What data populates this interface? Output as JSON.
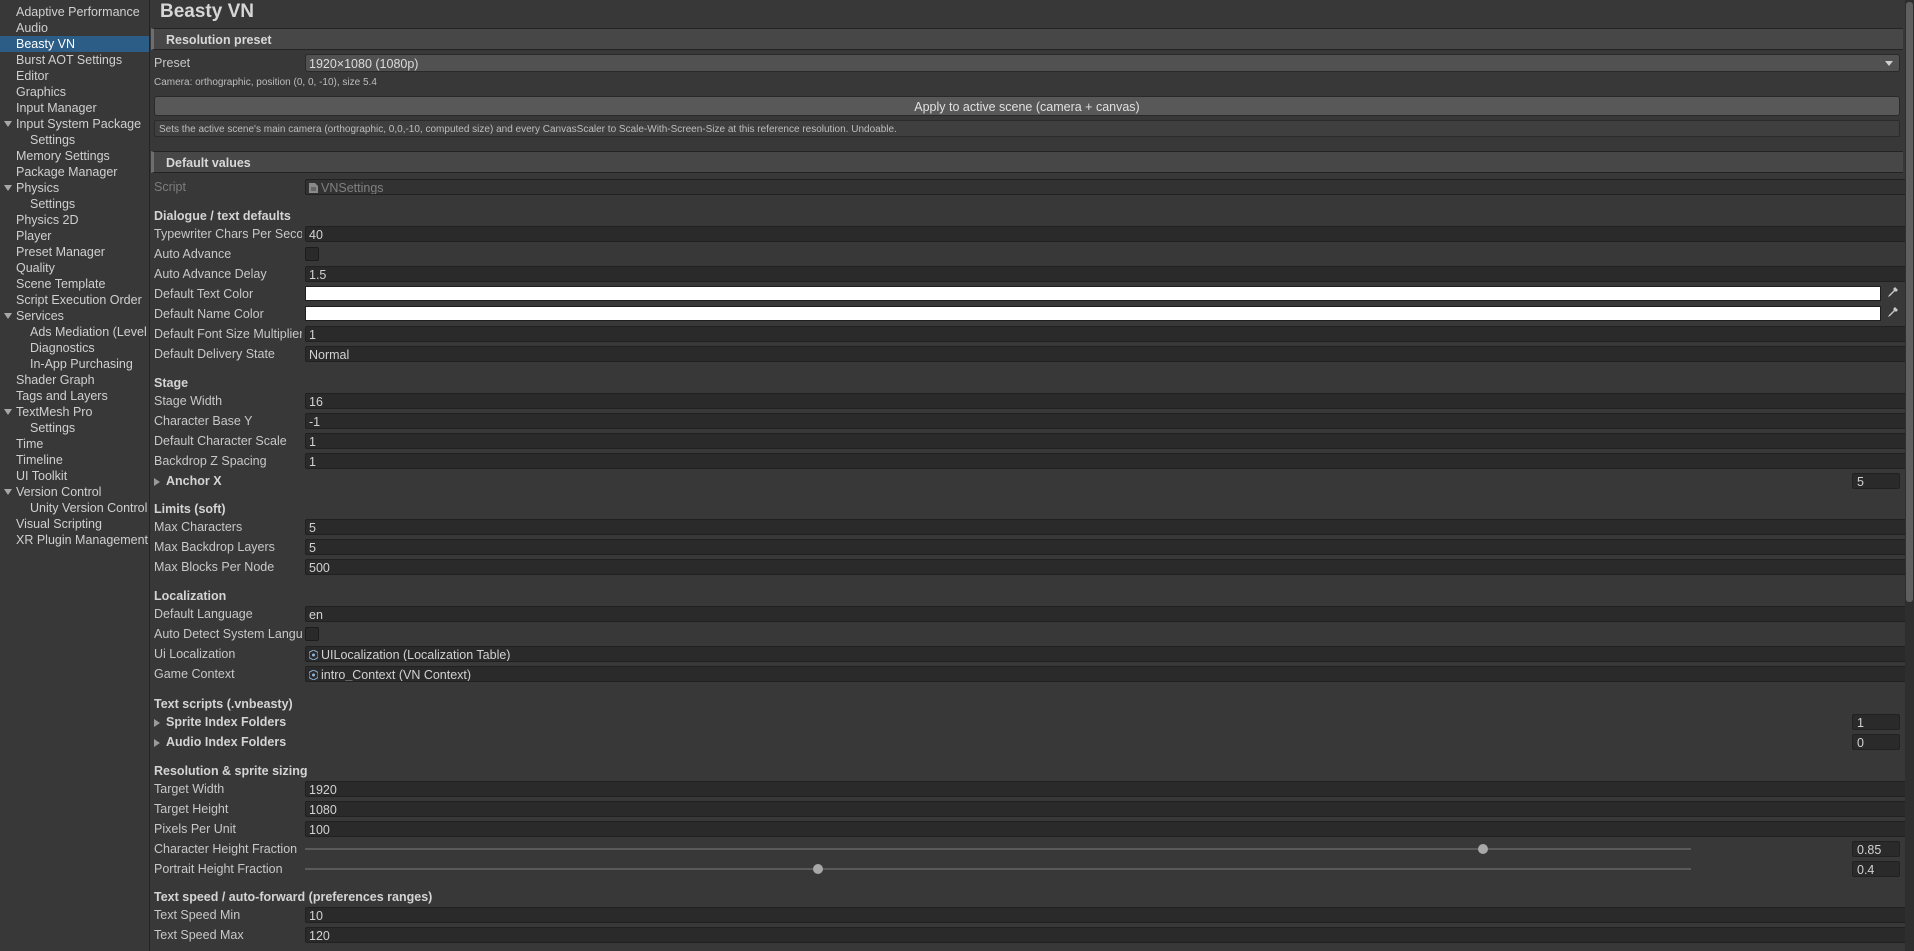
{
  "sidebar": {
    "selected": "Beasty VN",
    "items": [
      {
        "label": "Adaptive Performance",
        "indent": 0,
        "foldout": false
      },
      {
        "label": "Audio",
        "indent": 0,
        "foldout": false
      },
      {
        "label": "Beasty VN",
        "indent": 0,
        "foldout": false
      },
      {
        "label": "Burst AOT Settings",
        "indent": 0,
        "foldout": false
      },
      {
        "label": "Editor",
        "indent": 0,
        "foldout": false
      },
      {
        "label": "Graphics",
        "indent": 0,
        "foldout": false
      },
      {
        "label": "Input Manager",
        "indent": 0,
        "foldout": false
      },
      {
        "label": "Input System Package",
        "indent": 0,
        "foldout": true
      },
      {
        "label": "Settings",
        "indent": 1,
        "foldout": false
      },
      {
        "label": "Memory Settings",
        "indent": 0,
        "foldout": false
      },
      {
        "label": "Package Manager",
        "indent": 0,
        "foldout": false
      },
      {
        "label": "Physics",
        "indent": 0,
        "foldout": true
      },
      {
        "label": "Settings",
        "indent": 1,
        "foldout": false
      },
      {
        "label": "Physics 2D",
        "indent": 0,
        "foldout": false
      },
      {
        "label": "Player",
        "indent": 0,
        "foldout": false
      },
      {
        "label": "Preset Manager",
        "indent": 0,
        "foldout": false
      },
      {
        "label": "Quality",
        "indent": 0,
        "foldout": false
      },
      {
        "label": "Scene Template",
        "indent": 0,
        "foldout": false
      },
      {
        "label": "Script Execution Order",
        "indent": 0,
        "foldout": false
      },
      {
        "label": "Services",
        "indent": 0,
        "foldout": true
      },
      {
        "label": "Ads Mediation (Level",
        "indent": 1,
        "foldout": false
      },
      {
        "label": "Diagnostics",
        "indent": 1,
        "foldout": false
      },
      {
        "label": "In-App Purchasing",
        "indent": 1,
        "foldout": false
      },
      {
        "label": "Shader Graph",
        "indent": 0,
        "foldout": false
      },
      {
        "label": "Tags and Layers",
        "indent": 0,
        "foldout": false
      },
      {
        "label": "TextMesh Pro",
        "indent": 0,
        "foldout": true
      },
      {
        "label": "Settings",
        "indent": 1,
        "foldout": false
      },
      {
        "label": "Time",
        "indent": 0,
        "foldout": false
      },
      {
        "label": "Timeline",
        "indent": 0,
        "foldout": false
      },
      {
        "label": "UI Toolkit",
        "indent": 0,
        "foldout": false
      },
      {
        "label": "Version Control",
        "indent": 0,
        "foldout": true
      },
      {
        "label": "Unity Version Control",
        "indent": 1,
        "foldout": false
      },
      {
        "label": "Visual Scripting",
        "indent": 0,
        "foldout": false
      },
      {
        "label": "XR Plugin Management",
        "indent": 0,
        "foldout": false
      }
    ]
  },
  "page": {
    "title": "Beasty VN"
  },
  "resolution": {
    "header": "Resolution preset",
    "preset_label": "Preset",
    "preset_value": "1920×1080 (1080p)",
    "camera_note": "Camera: orthographic, position (0, 0, -10), size 5.4",
    "apply_button": "Apply to active scene (camera + canvas)",
    "help_text": "Sets the active scene's main camera (orthographic, 0,0,-10, computed size) and every CanvasScaler to Scale-With-Screen-Size at this reference resolution. Undoable."
  },
  "defaults": {
    "header": "Default values",
    "script_label": "Script",
    "script_value": "VNSettings"
  },
  "dialogue": {
    "title": "Dialogue / text defaults",
    "typewriter_label": "Typewriter Chars Per Seco",
    "typewriter_value": "40",
    "auto_advance_label": "Auto Advance",
    "auto_advance_delay_label": "Auto Advance Delay",
    "auto_advance_delay_value": "1.5",
    "text_color_label": "Default Text Color",
    "text_color_value": "#ffffff",
    "name_color_label": "Default Name Color",
    "name_color_value": "#ffffff",
    "font_size_mult_label": "Default Font Size Multiplier",
    "font_size_mult_value": "1",
    "delivery_state_label": "Default Delivery State",
    "delivery_state_value": "Normal"
  },
  "stage": {
    "title": "Stage",
    "stage_width_label": "Stage Width",
    "stage_width_value": "16",
    "char_base_y_label": "Character Base Y",
    "char_base_y_value": "-1",
    "char_scale_label": "Default Character Scale",
    "char_scale_value": "1",
    "backdrop_z_label": "Backdrop Z Spacing",
    "backdrop_z_value": "1",
    "anchor_x_label": "Anchor X",
    "anchor_x_size": "5"
  },
  "limits": {
    "title": "Limits (soft)",
    "max_chars_label": "Max Characters",
    "max_chars_value": "5",
    "max_backdrop_label": "Max Backdrop Layers",
    "max_backdrop_value": "5",
    "max_blocks_label": "Max Blocks Per Node",
    "max_blocks_value": "500"
  },
  "localization": {
    "title": "Localization",
    "default_lang_label": "Default Language",
    "default_lang_value": "en",
    "auto_detect_label": "Auto Detect System Langu",
    "ui_loc_label": "Ui Localization",
    "ui_loc_value": "UILocalization (Localization Table)",
    "game_ctx_label": "Game Context",
    "game_ctx_value": "intro_Context (VN Context)"
  },
  "textscripts": {
    "title": "Text scripts (.vnbeasty)",
    "sprite_folders_label": "Sprite Index Folders",
    "sprite_folders_size": "1",
    "audio_folders_label": "Audio Index Folders",
    "audio_folders_size": "0"
  },
  "sizing": {
    "title": "Resolution & sprite sizing",
    "target_width_label": "Target Width",
    "target_width_value": "1920",
    "target_height_label": "Target Height",
    "target_height_value": "1080",
    "ppu_label": "Pixels Per Unit",
    "ppu_value": "100",
    "char_height_label": "Character Height Fraction",
    "char_height_value": "0.85",
    "portrait_height_label": "Portrait Height Fraction",
    "portrait_height_value": "0.4"
  },
  "textspeed": {
    "title": "Text speed / auto-forward (preferences ranges)",
    "min_label": "Text Speed Min",
    "min_value": "10",
    "max_label": "Text Speed Max",
    "max_value": "120"
  },
  "colors": {
    "background": "#383838",
    "selection": "#2c5d87",
    "field": "#2a2a2a"
  }
}
